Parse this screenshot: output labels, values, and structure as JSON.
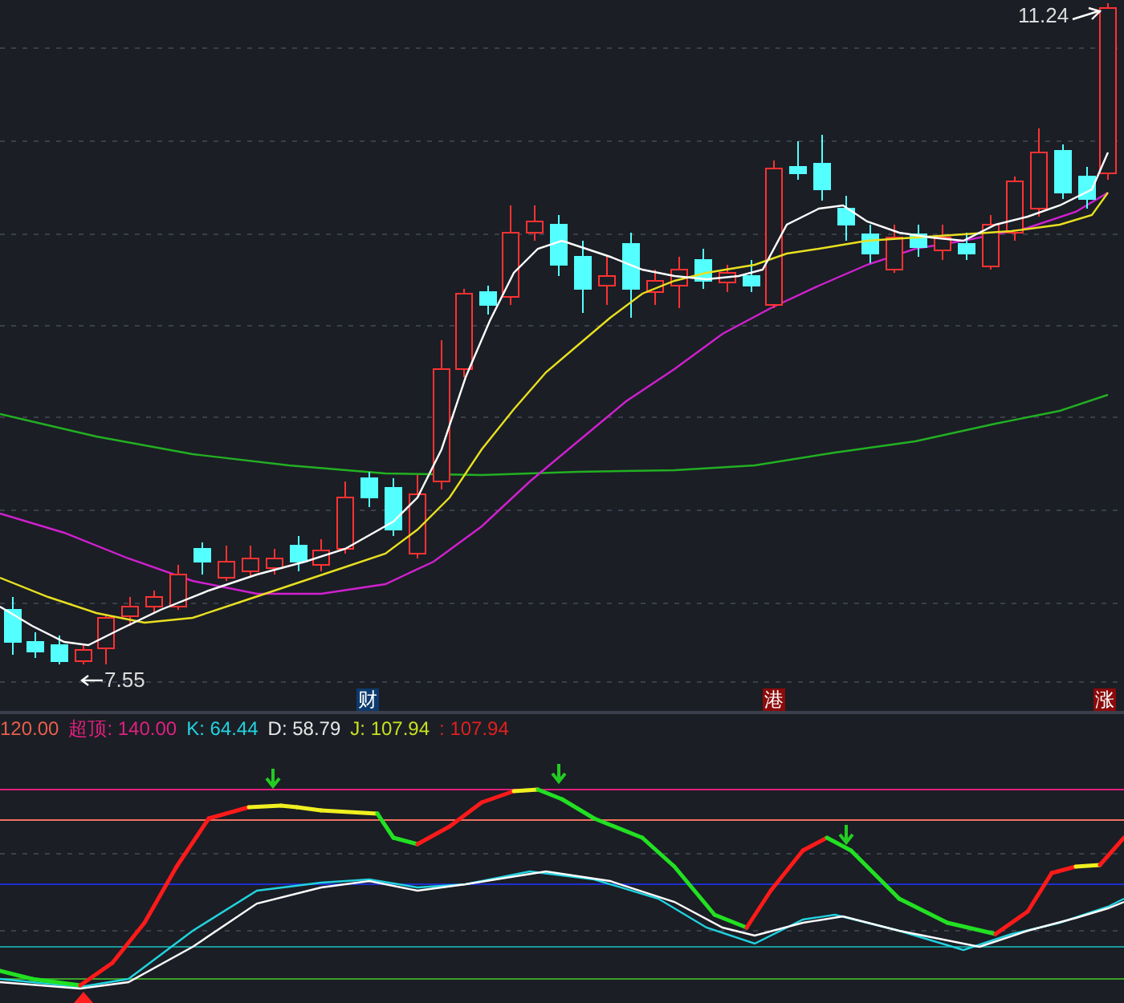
{
  "main_chart": {
    "high_label": "11.24",
    "low_label": "7.55",
    "event_markers": [
      {
        "label": "财",
        "kind": "info"
      },
      {
        "label": "港",
        "kind": "alert"
      },
      {
        "label": "涨",
        "kind": "alert"
      }
    ]
  },
  "indicator_legend": [
    {
      "text": "120.00",
      "color": "#e8604c"
    },
    {
      "text": "超顶: 140.00",
      "color": "#e0207f"
    },
    {
      "text": "K: 64.44",
      "color": "#22d3e0"
    },
    {
      "text": "D: 58.79",
      "color": "#e6e6e6"
    },
    {
      "text": "J: 107.94",
      "color": "#c8e020"
    },
    {
      "text": ": 107.94",
      "color": "#e02020"
    }
  ]
}
